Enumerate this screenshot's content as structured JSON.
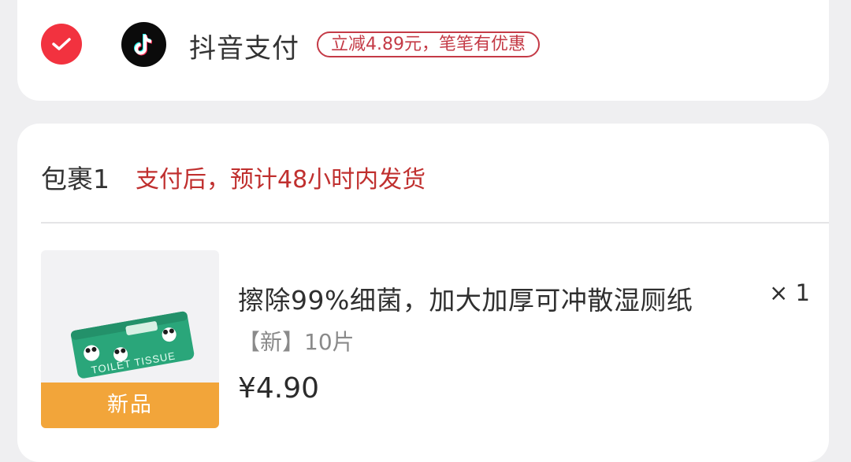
{
  "payment": {
    "method_name": "抖音支付",
    "promo": "立减4.89元，笔笔有优惠",
    "selected": true,
    "check_color": "#f2323f",
    "logo_icon": "douyin-logo-icon"
  },
  "package": {
    "title": "包裹1",
    "shipping_note": "支付后，预计48小时内发货",
    "shipping_note_color": "#c0302f",
    "item": {
      "title": "擦除99%细菌，加大加厚可冲散湿厕纸",
      "quantity": "× 1",
      "variant": "【新】10片",
      "price": "¥4.90",
      "badge": "新品",
      "badge_color": "#f2a53a",
      "image_text": "TOILET TISSUE"
    }
  }
}
